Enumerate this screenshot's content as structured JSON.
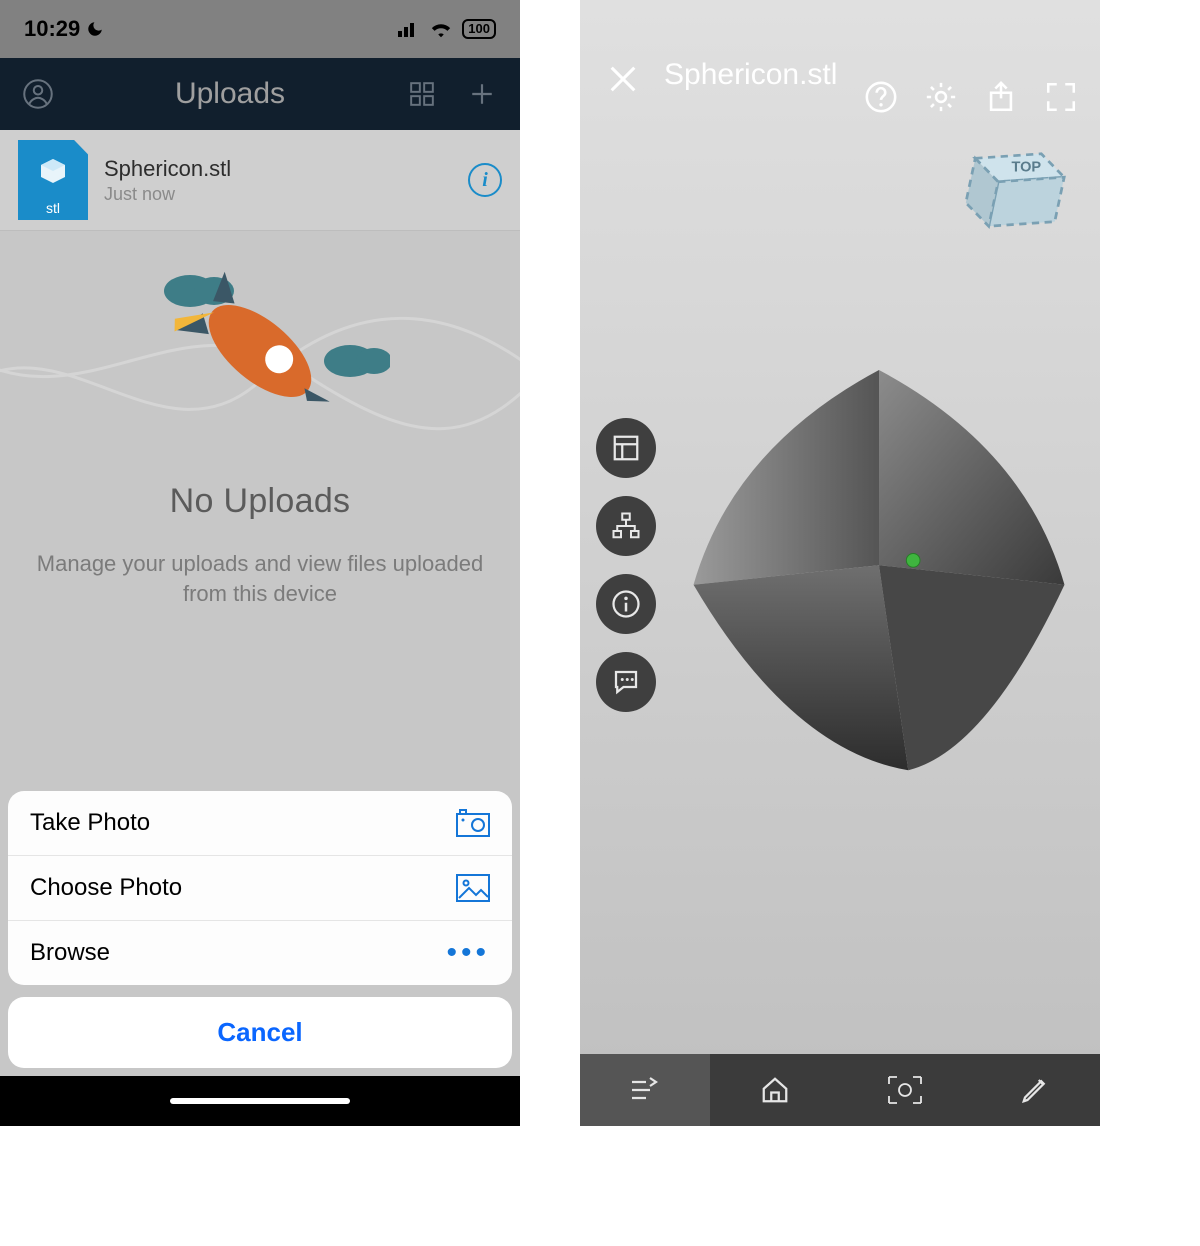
{
  "left": {
    "status": {
      "time": "10:29",
      "battery": "100"
    },
    "navbar": {
      "title": "Uploads"
    },
    "file": {
      "name": "Sphericon.stl",
      "ext": "stl",
      "time": "Just now"
    },
    "empty": {
      "heading": "No Uploads",
      "sub": "Manage your uploads and view files uploaded from this device"
    },
    "sheet": {
      "opt1": "Take Photo",
      "opt2": "Choose Photo",
      "opt3": "Browse",
      "cancel": "Cancel"
    }
  },
  "right": {
    "title": "Sphericon.stl",
    "cube_label": "TOP",
    "tools": {
      "t1": "panel-toggle",
      "t2": "model-tree",
      "t3": "info",
      "t4": "comments"
    },
    "bottombar": {
      "b1": "steps",
      "b2": "home",
      "b3": "camera",
      "b4": "markup"
    }
  }
}
